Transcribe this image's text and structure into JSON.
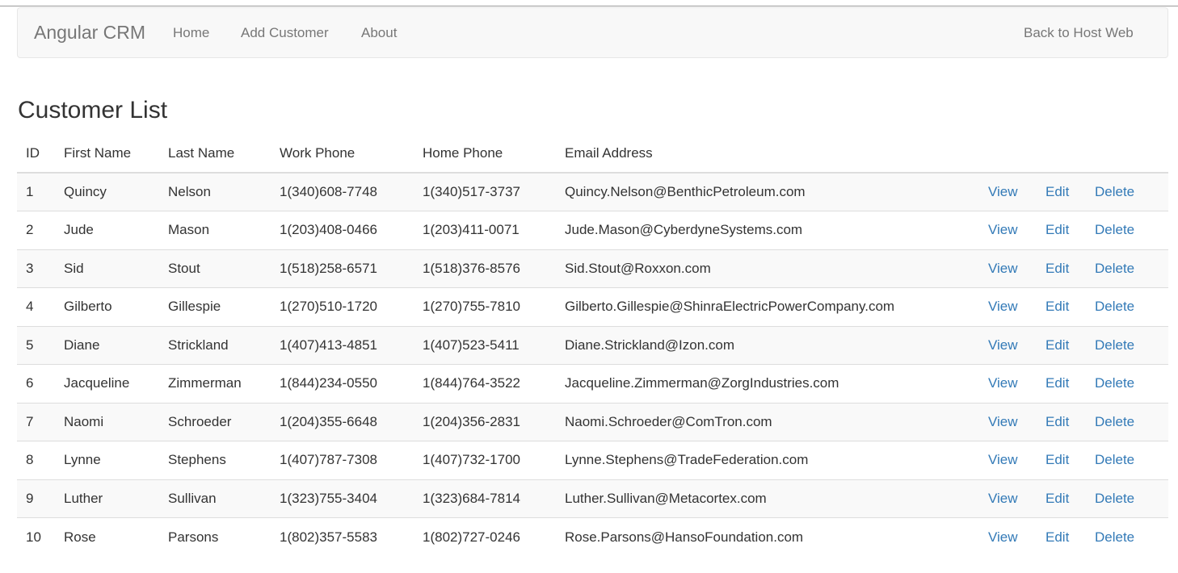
{
  "navbar": {
    "brand": "Angular CRM",
    "links": [
      "Home",
      "Add Customer",
      "About"
    ],
    "right_link": "Back to Host Web"
  },
  "page_title": "Customer List",
  "table": {
    "headers": [
      "ID",
      "First Name",
      "Last Name",
      "Work Phone",
      "Home Phone",
      "Email Address"
    ],
    "action_labels": {
      "view": "View",
      "edit": "Edit",
      "delete": "Delete"
    },
    "rows": [
      [
        "1",
        "Quincy",
        "Nelson",
        "1(340)608-7748",
        "1(340)517-3737",
        "Quincy.Nelson@BenthicPetroleum.com"
      ],
      [
        "2",
        "Jude",
        "Mason",
        "1(203)408-0466",
        "1(203)411-0071",
        "Jude.Mason@CyberdyneSystems.com"
      ],
      [
        "3",
        "Sid",
        "Stout",
        "1(518)258-6571",
        "1(518)376-8576",
        "Sid.Stout@Roxxon.com"
      ],
      [
        "4",
        "Gilberto",
        "Gillespie",
        "1(270)510-1720",
        "1(270)755-7810",
        "Gilberto.Gillespie@ShinraElectricPowerCompany.com"
      ],
      [
        "5",
        "Diane",
        "Strickland",
        "1(407)413-4851",
        "1(407)523-5411",
        "Diane.Strickland@Izon.com"
      ],
      [
        "6",
        "Jacqueline",
        "Zimmerman",
        "1(844)234-0550",
        "1(844)764-3522",
        "Jacqueline.Zimmerman@ZorgIndustries.com"
      ],
      [
        "7",
        "Naomi",
        "Schroeder",
        "1(204)355-6648",
        "1(204)356-2831",
        "Naomi.Schroeder@ComTron.com"
      ],
      [
        "8",
        "Lynne",
        "Stephens",
        "1(407)787-7308",
        "1(407)732-1700",
        "Lynne.Stephens@TradeFederation.com"
      ],
      [
        "9",
        "Luther",
        "Sullivan",
        "1(323)755-3404",
        "1(323)684-7814",
        "Luther.Sullivan@Metacortex.com"
      ],
      [
        "10",
        "Rose",
        "Parsons",
        "1(802)357-5583",
        "1(802)727-0246",
        "Rose.Parsons@HansoFoundation.com"
      ]
    ]
  },
  "colors": {
    "link": "#337ab7",
    "navbar_bg": "#f8f8f8",
    "stripe": "#f9f9f9"
  }
}
